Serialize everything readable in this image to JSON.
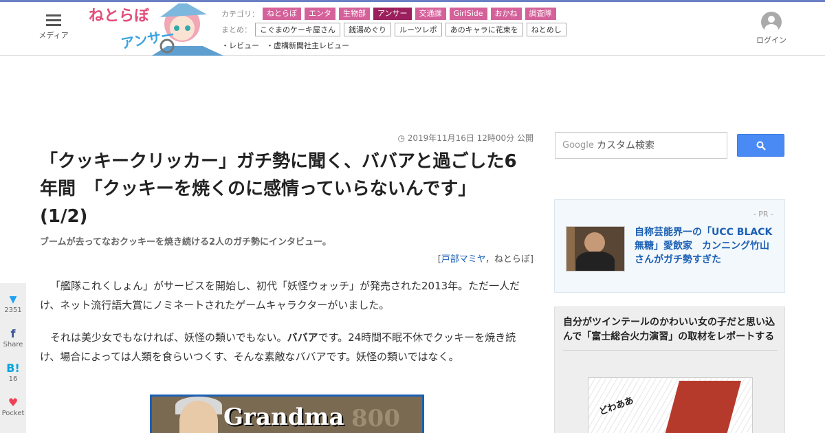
{
  "header": {
    "menu_label": "メディア",
    "logo_text": "ねとらぼ",
    "logo_sub": "アンサー",
    "category_label": "カテゴリ：",
    "categories": [
      {
        "label": "ねとらぼ",
        "active": false
      },
      {
        "label": "エンタ",
        "active": false
      },
      {
        "label": "生物部",
        "active": false
      },
      {
        "label": "アンサー",
        "active": true
      },
      {
        "label": "交通課",
        "active": false
      },
      {
        "label": "GirlSide",
        "active": false
      },
      {
        "label": "おかね",
        "active": false
      },
      {
        "label": "調査隊",
        "active": false
      }
    ],
    "matome_label": "まとめ：",
    "matome": [
      "こぐまのケーキ屋さん",
      "銭湯めぐり",
      "ルーツレポ",
      "あのキャラに花束を",
      "ねとめし"
    ],
    "reviews": [
      "・レビュー",
      "・虚構新聞社主レビュー"
    ],
    "login_label": "ログイン"
  },
  "article": {
    "date": "2019年11月16日 12時00分 公開",
    "title": "「クッキークリッカー」ガチ勢に聞く、ババアと過ごした6年間　「クッキーを焼くのに感情っていらないんです」 (1/2)",
    "subtitle": "ブームが去ってなおクッキーを焼き続ける2人のガチ勢にインタビュー。",
    "byline_open": "[",
    "byline_author": "戸部マミヤ",
    "byline_sep": "，",
    "byline_site": "ねとらぼ",
    "byline_close": "]",
    "p1": "「艦隊これくしょん」がサービスを開始し、初代「妖怪ウォッチ」が発売された2013年。ただ一人だけ、ネット流行語大賞にノミネートされたゲームキャラクターがいました。",
    "p2_before": "それは美少女でもなければ、妖怪の類いでもない。",
    "p2_bold": "ババア",
    "p2_after": "です。24時間不眠不休でクッキーを焼き続け、場合によっては人類を食らいつくす、そんな素敵なババアです。妖怪の類いではなく。",
    "image_text": "Grandma",
    "image_num": "800"
  },
  "share": [
    {
      "icon": "twitter-icon",
      "glyph": "🐦",
      "count": "2351",
      "color": "#1da1f2"
    },
    {
      "icon": "facebook-icon",
      "glyph": "f",
      "count": "Share",
      "color": "#3b5998"
    },
    {
      "icon": "hatena-icon",
      "glyph": "B!",
      "count": "16",
      "color": "#00a4de"
    },
    {
      "icon": "pocket-icon",
      "glyph": "♥",
      "count": "Pocket",
      "color": "#ef4056"
    }
  ],
  "search": {
    "brand": "Google",
    "placeholder": "カスタム検索"
  },
  "pr": {
    "label": "- PR -",
    "link": "自称芸能界一の「UCC BLACK無糖」愛飲家　カンニング竹山さんがガチ勢すぎた"
  },
  "related": {
    "title": "自分がツインテールのかわいい女の子だと思い込んで「富士総合火力演習」の取材をレポートする",
    "img_text": "どわああ"
  }
}
